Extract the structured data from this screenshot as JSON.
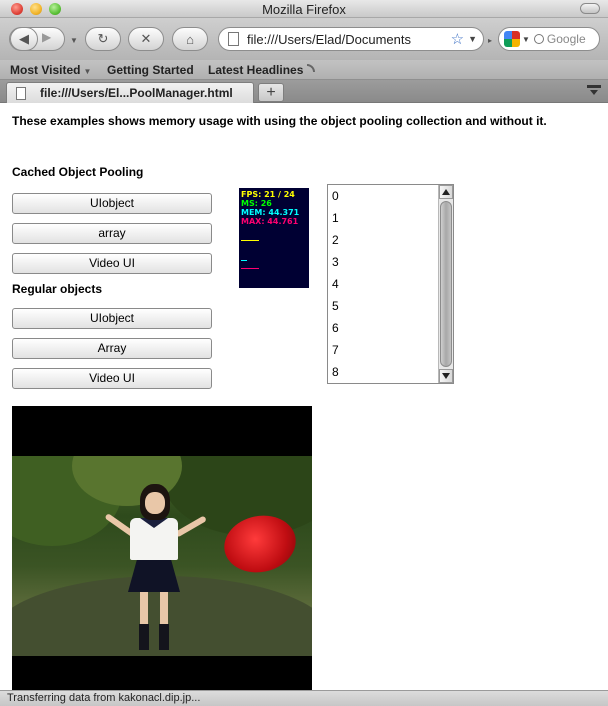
{
  "window": {
    "title": "Mozilla Firefox"
  },
  "toolbar": {
    "url": "file:///Users/Elad/Documents",
    "search_placeholder": "Google"
  },
  "bookmarks": {
    "items": [
      "Most Visited",
      "Getting Started",
      "Latest Headlines"
    ]
  },
  "tabs": {
    "active_title": "file:///Users/El...PoolManager.html",
    "new_tab_label": "+"
  },
  "page": {
    "intro": "These examples shows memory usage with using the object pooling collection and without it.",
    "cached_section": {
      "heading": "Cached Object Pooling",
      "buttons": [
        "UIobject",
        "array",
        "Video UI"
      ]
    },
    "regular_section": {
      "heading": "Regular objects",
      "buttons": [
        "UIobject",
        "Array",
        "Video UI"
      ]
    },
    "stats": {
      "fps": "FPS: 21 / 24",
      "ms": "MS: 26",
      "mem": "MEM: 44.371",
      "max": "MAX: 44.761"
    },
    "list": {
      "items": [
        "0",
        "1",
        "2",
        "3",
        "4",
        "5",
        "6",
        "7",
        "8"
      ]
    }
  },
  "status": {
    "text": "Transferring data from kakonacl.dip.jp..."
  },
  "colors": {
    "stats_bg": "#000033",
    "fps": "#ffff00",
    "ms": "#00ff00",
    "mem": "#00ffff",
    "max": "#ff0070"
  }
}
